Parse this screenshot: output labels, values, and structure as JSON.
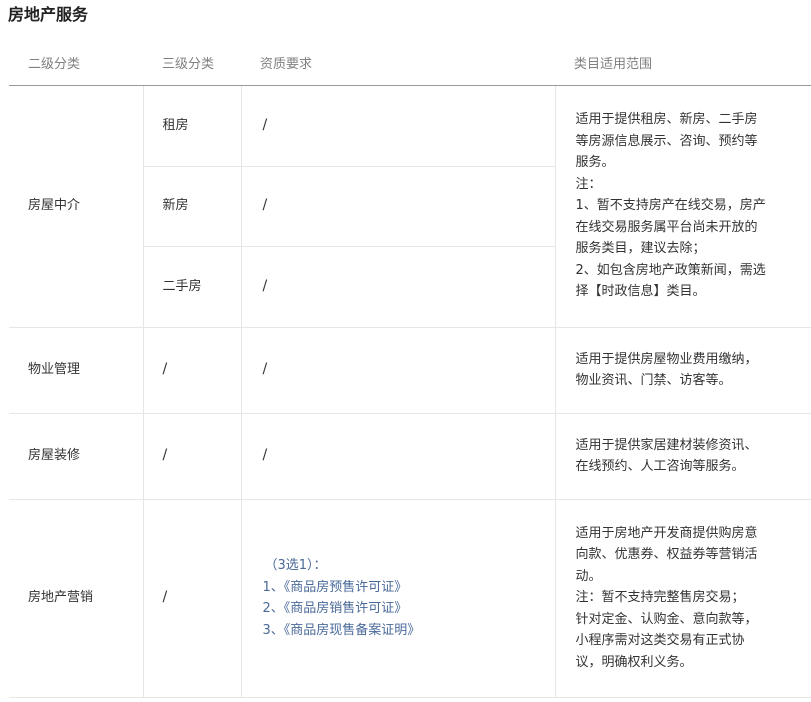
{
  "title": "房地产服务",
  "headers": [
    "二级分类",
    "三级分类",
    "资质要求",
    "类目适用范围"
  ],
  "rows": {
    "housing": {
      "category": "房屋中介",
      "subs": [
        {
          "name": "租房",
          "qual": "/"
        },
        {
          "name": "新房",
          "qual": "/"
        },
        {
          "name": "二手房",
          "qual": "/"
        }
      ],
      "scope": [
        "适用于提供租房、新房、二手房",
        "等房源信息展示、咨询、预约等",
        "服务。",
        "注：",
        "1、暂不支持房产在线交易，房产",
        "在线交易服务属平台尚未开放的",
        "服务类目，建议去除；",
        "2、如包含房地产政策新闻，需选",
        "择【时政信息】类目。"
      ]
    },
    "property": {
      "category": "物业管理",
      "sub": "/",
      "qual": "/",
      "scope": [
        "适用于提供房屋物业费用缴纳，",
        "物业资讯、门禁、访客等。"
      ]
    },
    "decoration": {
      "category": "房屋装修",
      "sub": "/",
      "qual": "/",
      "scope": [
        "适用于提供家居建材装修资讯、",
        "在线预约、人工咨询等服务。"
      ]
    },
    "marketing": {
      "category": "房地产营销",
      "sub": "/",
      "qual": [
        "（3选1）：",
        "1、《商品房预售许可证》",
        "2、《商品房销售许可证》",
        "3、《商品房现售备案证明》"
      ],
      "scope": [
        "适用于房地产开发商提供购房意",
        "向款、优惠券、权益券等营销活",
        "动。",
        "注：暂不支持完整售房交易；",
        "针对定金、认购金、意向款等，",
        "小程序需对这类交易有正式协",
        "议，明确权利义务。"
      ]
    }
  }
}
